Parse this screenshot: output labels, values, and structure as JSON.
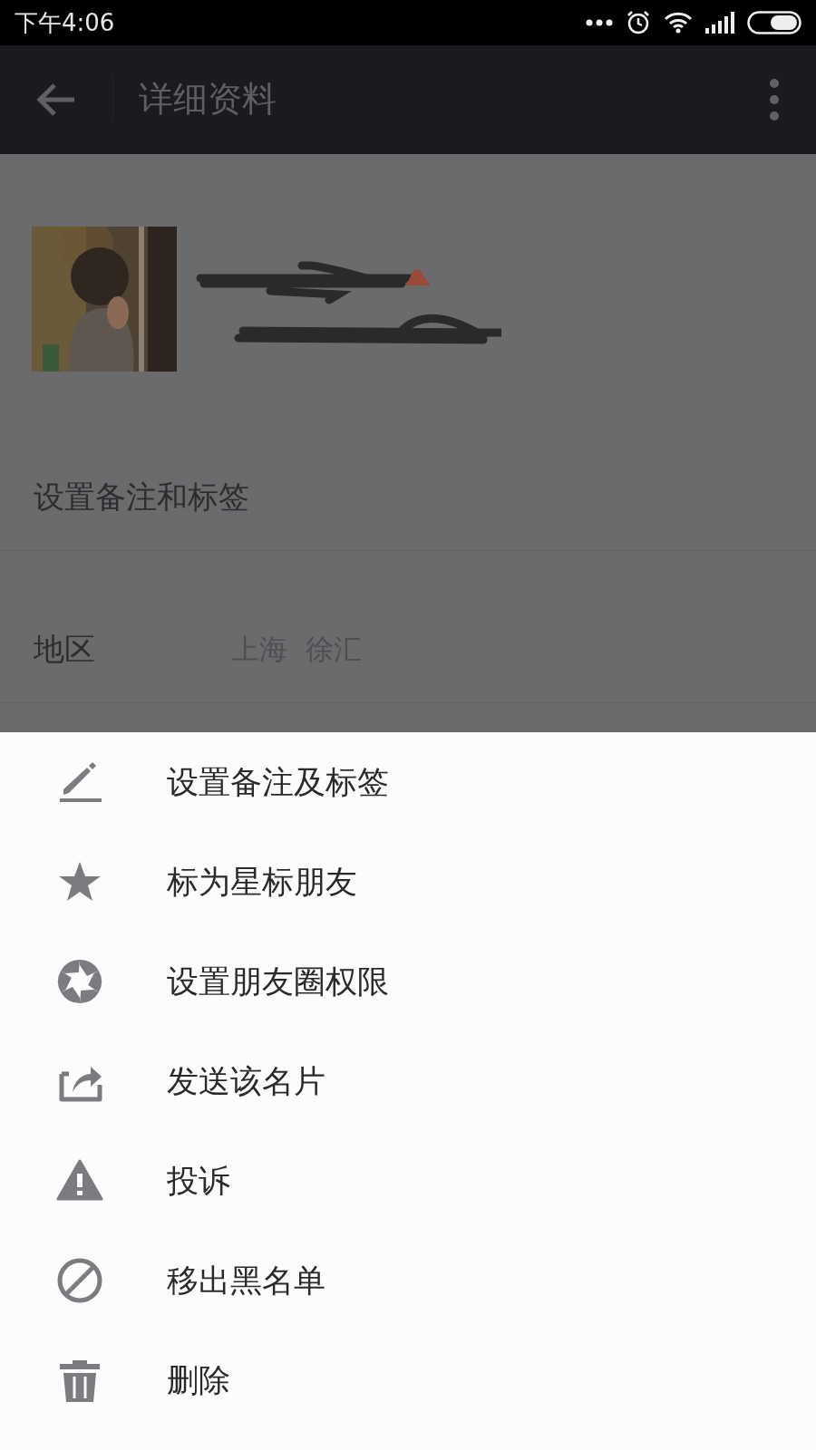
{
  "status_bar": {
    "time": "下午4:06"
  },
  "app_bar": {
    "title": "详细资料"
  },
  "rows": [
    {
      "label": "设置备注和标签"
    },
    {
      "label": "地区",
      "value": "上海  徐汇"
    }
  ],
  "sheet": {
    "items": [
      {
        "kind": "edit",
        "label": "设置备注及标签"
      },
      {
        "kind": "star",
        "label": "标为星标朋友"
      },
      {
        "kind": "moments",
        "label": "设置朋友圈权限"
      },
      {
        "kind": "share",
        "label": "发送该名片"
      },
      {
        "kind": "report",
        "label": "投诉"
      },
      {
        "kind": "block",
        "label": "移出黑名单"
      },
      {
        "kind": "delete",
        "label": "删除"
      }
    ]
  }
}
